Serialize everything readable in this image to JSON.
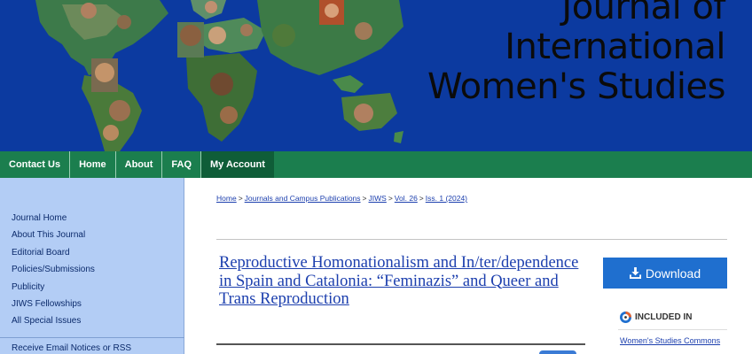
{
  "header": {
    "title_lines": [
      "Journal of",
      "International",
      "Women's Studies"
    ]
  },
  "nav": {
    "items": [
      "Contact Us",
      "Home",
      "About",
      "FAQ",
      "My Account"
    ]
  },
  "sidebar": {
    "items": [
      "Journal Home",
      "About This Journal",
      "Editorial Board",
      "Policies/Submissions",
      "Publicity",
      "JIWS Fellowships",
      "All Special Issues"
    ],
    "email_notice": "Receive Email Notices or RSS"
  },
  "breadcrumb": [
    "Home",
    "Journals and Campus Publications",
    "JIWS",
    "Vol. 26",
    "Iss. 1 (2024)"
  ],
  "breadcrumb_separator": ">",
  "article": {
    "title": "Reproductive Homonationalism and In/ter/dependence in Spain and Catalonia: “Feminazis” and Queer and Trans Reproduction"
  },
  "download": {
    "label": "Download",
    "icon": "download-icon"
  },
  "included_in": {
    "heading": "INCLUDED IN",
    "icon": "network-icon",
    "link": "Women's Studies Commons"
  },
  "colors": {
    "banner": "#0c3aa0",
    "nav": "#1b7e4e",
    "nav_active": "#0f5d38",
    "sidebar": "#b3cdf5",
    "link": "#1c3fae",
    "download": "#1f6fcf"
  }
}
